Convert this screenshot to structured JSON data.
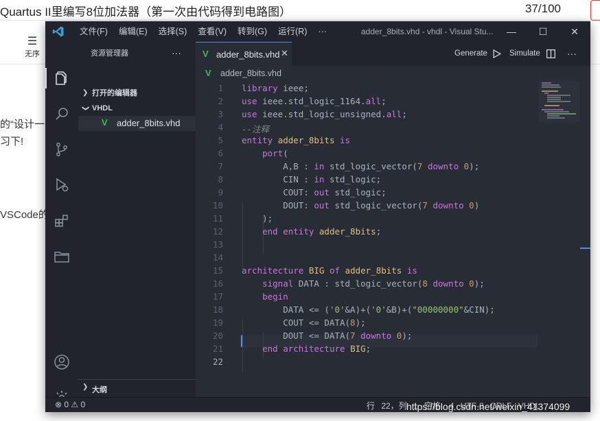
{
  "background": {
    "title": "Quartus II里编写8位加法器（第一次由代码得到电路图）",
    "count": "37/100",
    "toolbar_label": "无序",
    "snippets": [
      "的“设计一",
      "习下!",
      "VSCode的"
    ]
  },
  "window": {
    "title": "adder_8bits.vhd - vhdl - Visual Stu...",
    "menu": [
      "文件(F)",
      "编辑(E)",
      "选择(S)",
      "查看(V)",
      "转到(G)",
      "运行(R)",
      "···"
    ]
  },
  "sidebar": {
    "header": "资源管理器",
    "open_editors": "打开的编辑器",
    "folder": "VHDL",
    "file": "adder_8bits.vhd",
    "outline": "大纲"
  },
  "editor": {
    "tab": "adder_8bits.vhd",
    "breadcrumb": "adder_8bits.vhd",
    "generate": "Generate",
    "simulate": "Simulate"
  },
  "code_lines": [
    "1",
    "2",
    "3",
    "4",
    "5",
    "6",
    "7",
    "8",
    "9",
    "10",
    "11",
    "12",
    "13",
    "14",
    "15",
    "16",
    "17",
    "18",
    "19",
    "20",
    "21",
    "22"
  ],
  "status": {
    "problems": "⊗ 0 ⚠ 0",
    "right": "行 22，列 1  空格: 4  UTF-8  CRLF  VHDL"
  },
  "watermark": "https://blog.csdn.net/weixin_41374099"
}
